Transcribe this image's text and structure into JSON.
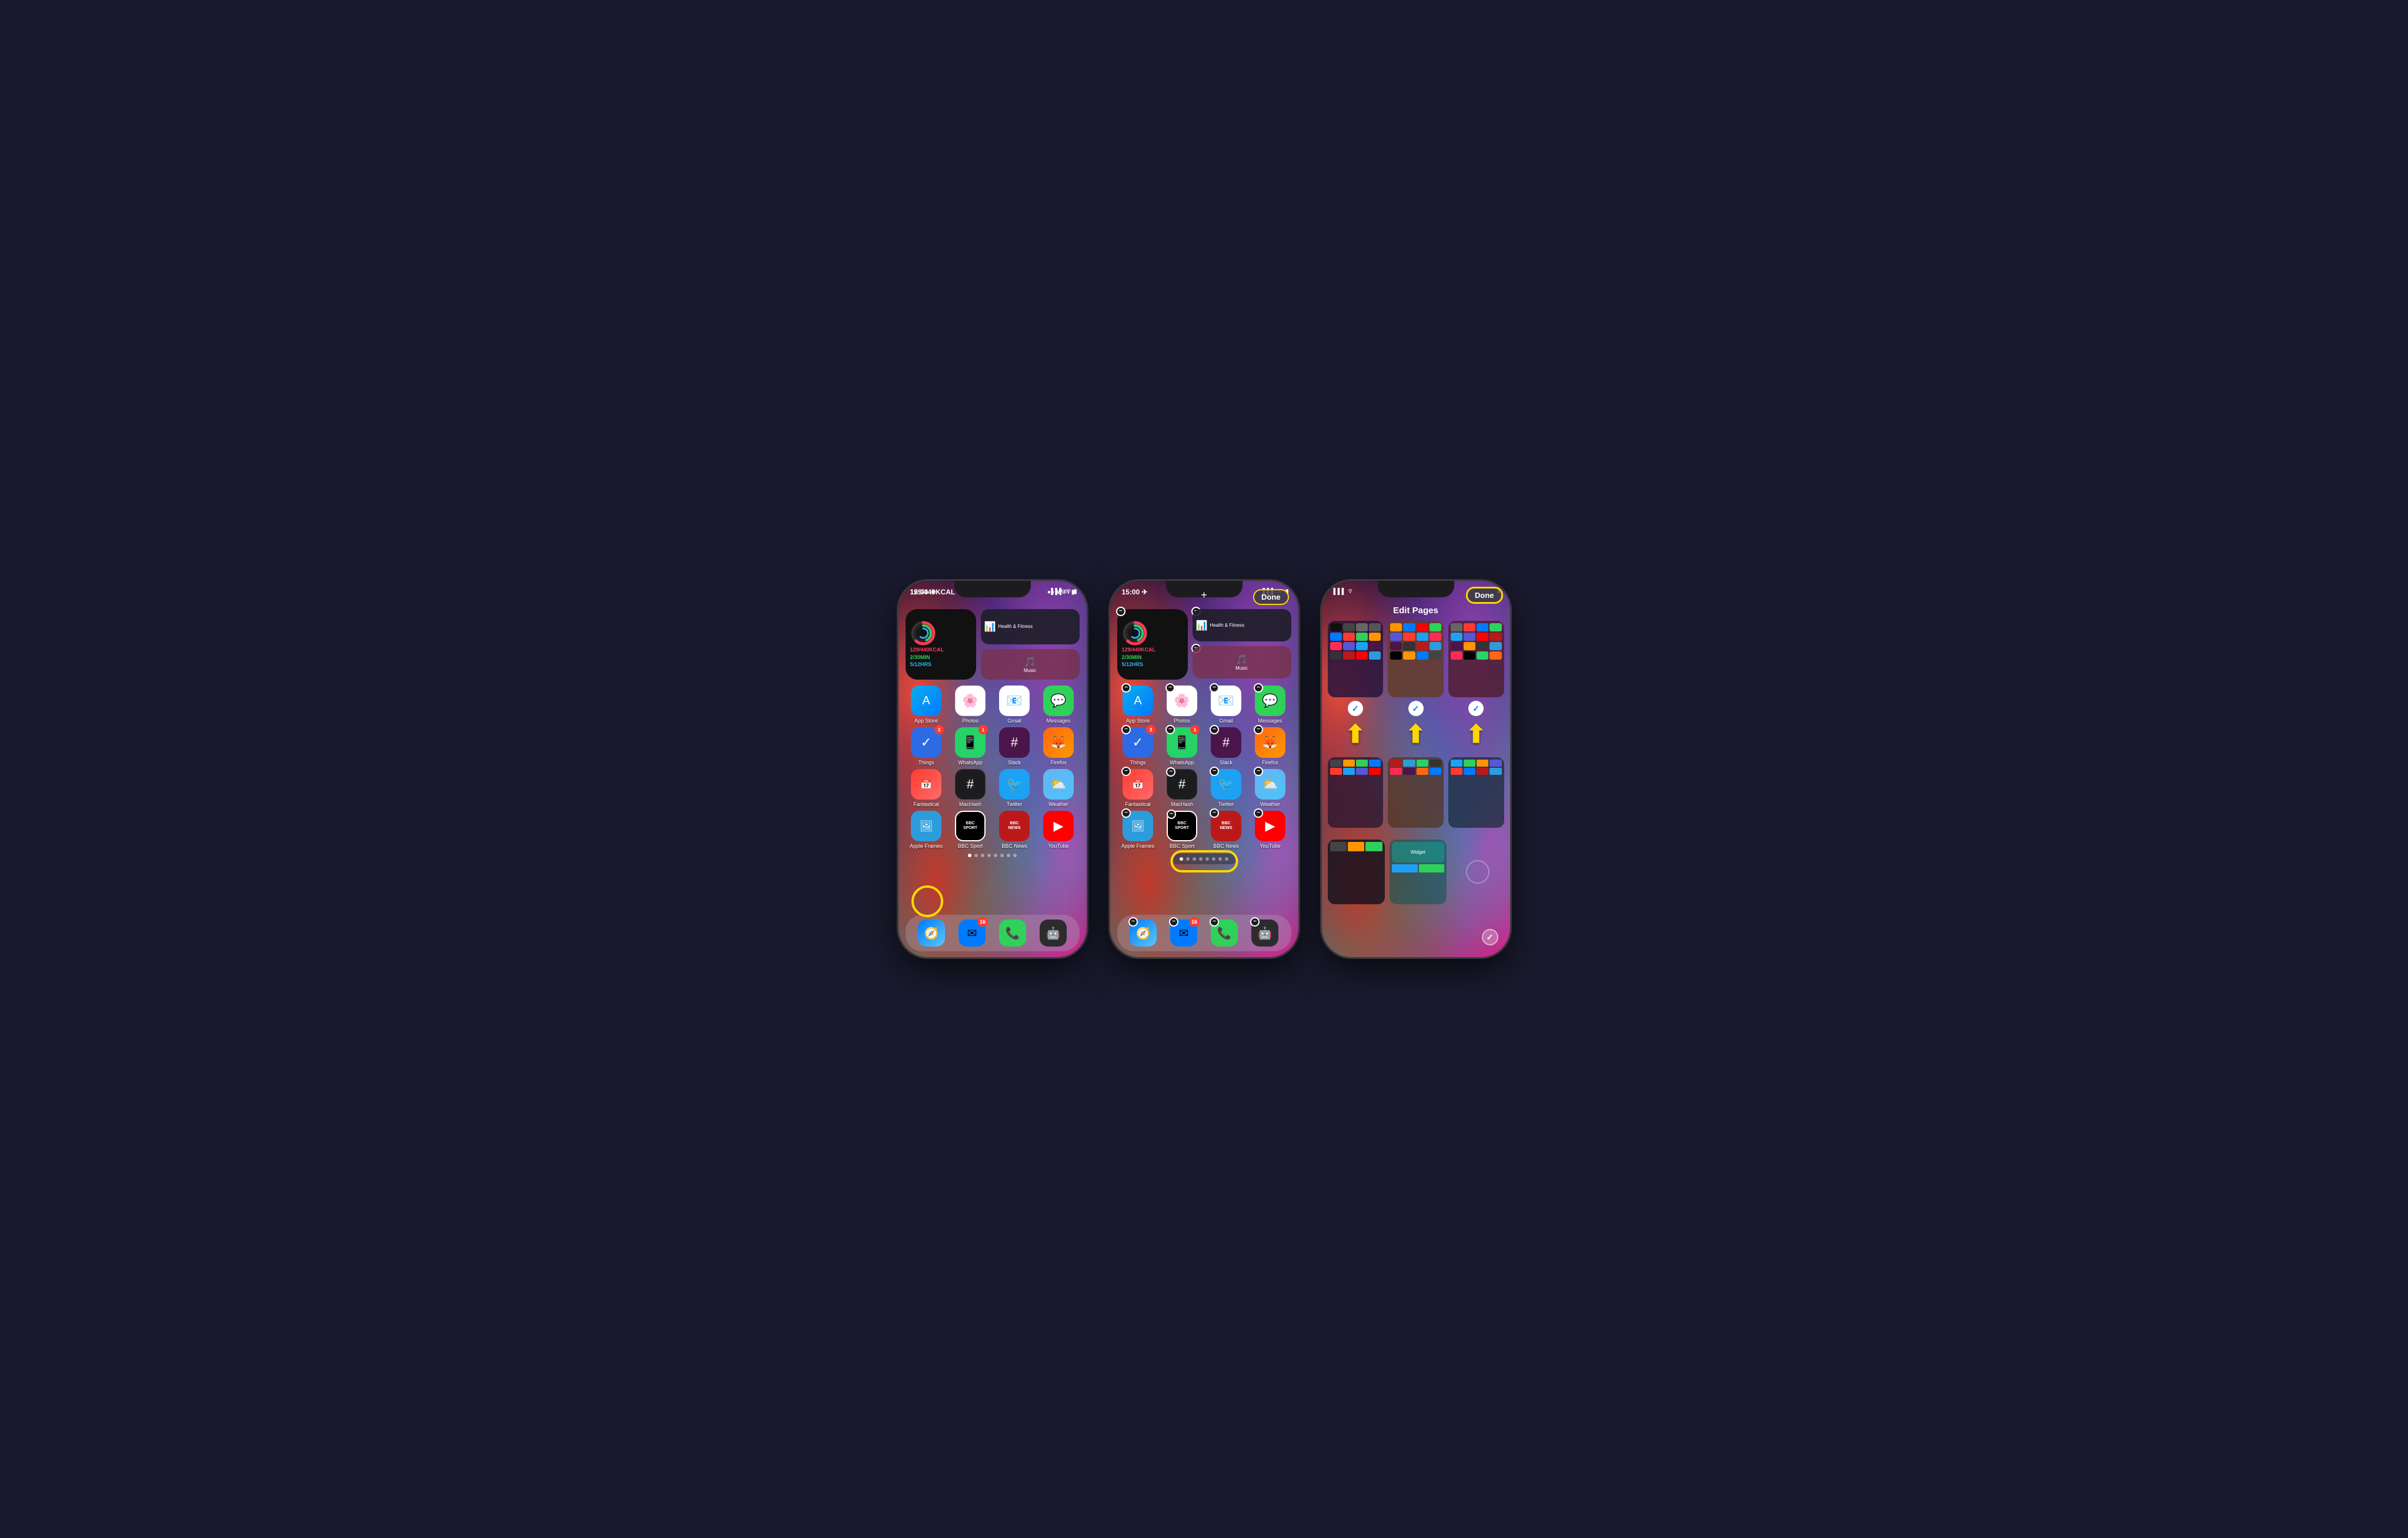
{
  "scene": {
    "background": "#1a1a2e"
  },
  "phone1": {
    "statusBar": {
      "time": "15:00",
      "signal": "●●●",
      "wifi": "WiFi",
      "battery": "🔋"
    },
    "widget": {
      "calories": "129/440KCAL",
      "minutes": "2/30MIN",
      "hours": "5/12HRS"
    },
    "apps": [
      {
        "label": "Fitness",
        "icon": "🏃",
        "bg": "dark"
      },
      {
        "label": "Health & Fitness",
        "icon": "📊",
        "bg": "dark"
      },
      {
        "label": "Music",
        "icon": "🎵",
        "bg": "music"
      },
      {
        "label": "App Store",
        "icon": "A",
        "bg": "appstore"
      },
      {
        "label": "Photos",
        "icon": "📷",
        "bg": "photos"
      },
      {
        "label": "Gmail",
        "icon": "M",
        "bg": "gmail"
      },
      {
        "label": "Messages",
        "icon": "💬",
        "bg": "messages"
      },
      {
        "label": "Things",
        "icon": "✓",
        "bg": "things",
        "badge": "3"
      },
      {
        "label": "WhatsApp",
        "icon": "📱",
        "bg": "whatsapp",
        "badge": "1"
      },
      {
        "label": "Slack",
        "icon": "#",
        "bg": "slack"
      },
      {
        "label": "Firefox",
        "icon": "🦊",
        "bg": "firefox"
      },
      {
        "label": "Fantastical",
        "icon": "📅",
        "bg": "fantastical"
      },
      {
        "label": "MacHash",
        "icon": "#",
        "bg": "machash"
      },
      {
        "label": "Twitter",
        "icon": "🐦",
        "bg": "twitter"
      },
      {
        "label": "Weather",
        "icon": "⛅",
        "bg": "weather"
      },
      {
        "label": "Apple Frames",
        "icon": "🖼",
        "bg": "appleframes"
      },
      {
        "label": "BBC Sport",
        "icon": "S",
        "bg": "bbcsport"
      },
      {
        "label": "BBC News",
        "icon": "N",
        "bg": "bbcnews"
      },
      {
        "label": "YouTube",
        "icon": "▶",
        "bg": "youtube"
      }
    ],
    "dock": [
      {
        "label": "Safari",
        "bg": "safari",
        "icon": "🧭"
      },
      {
        "label": "Mail",
        "bg": "mail",
        "icon": "✉",
        "badge": "16"
      },
      {
        "label": "Phone",
        "bg": "phone",
        "icon": "📞"
      },
      {
        "label": "Bot",
        "bg": "dark",
        "icon": "🤖"
      }
    ],
    "highlight": "yellow-circle-dots"
  },
  "phone2": {
    "statusBar": {
      "time": "15:00"
    },
    "topButtons": {
      "plus": "+",
      "done": "Done"
    },
    "highlight": "yellow-rect-dots"
  },
  "phone3": {
    "header": "Edit Pages",
    "doneButton": "Done",
    "highlight": "yellow-circle-done"
  },
  "arrows": {
    "count": 3
  },
  "labels": {
    "fitnessCalories": "129/440KCAL",
    "fitnessMinutes": "2/30MIN",
    "fitnessHours": "5/12HRS",
    "appStoreLabel": "App Store",
    "whatsappLabel": "WhatsApp",
    "thingsLabel": "Things",
    "healthLabel": "Health & Fitness",
    "appleFramesLabel": "Apple Frames",
    "editPagesTitle": "Edit Pages",
    "doneLabel": "Done"
  }
}
